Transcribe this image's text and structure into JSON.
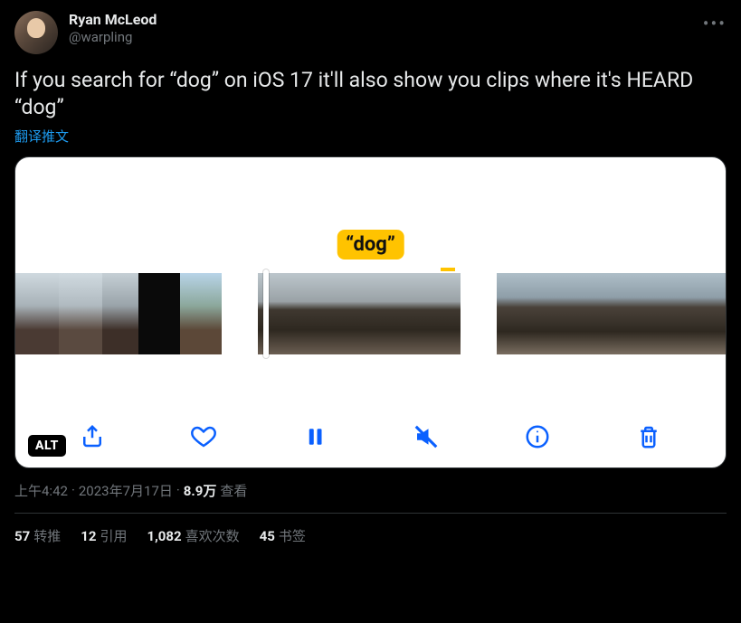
{
  "author": {
    "display_name": "Ryan McLeod",
    "handle": "@warpling"
  },
  "tweet_text": "If you search for “dog” on iOS 17 it'll also show you clips where it's HEARD “dog”",
  "translate_label": "翻译推文",
  "media": {
    "search_term": "“dog”",
    "alt_badge": "ALT"
  },
  "meta": {
    "time": "上午4:42",
    "separator": " · ",
    "date": "2023年7月17日",
    "views_number": "8.9万",
    "views_label": " 查看"
  },
  "stats": {
    "retweets_count": "57",
    "retweets_label": "转推",
    "quotes_count": "12",
    "quotes_label": "引用",
    "likes_count": "1,082",
    "likes_label": "喜欢次数",
    "bookmarks_count": "45",
    "bookmarks_label": "书签"
  }
}
